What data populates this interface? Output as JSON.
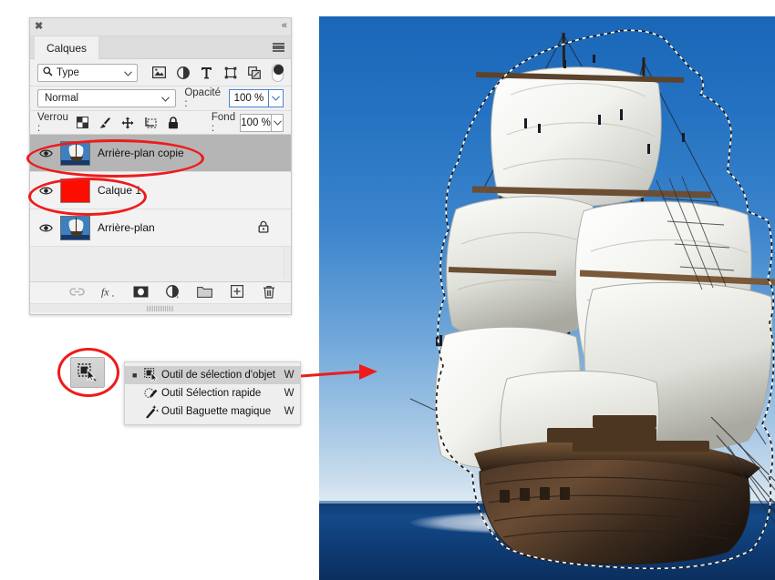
{
  "panel": {
    "title_tab": "Calques",
    "close_glyph": "✖",
    "collapse_glyph": "«",
    "filter": {
      "kind_value": "Type",
      "search_icon": "search-icon",
      "chevron": "∨",
      "icons": [
        "pixel-layer-filter-icon",
        "adjustment-layer-filter-icon",
        "type-layer-filter-icon",
        "shape-layer-filter-icon",
        "smart-object-filter-icon"
      ],
      "toggle_name": "filter-enable-toggle"
    },
    "blend": {
      "mode_value": "Normal",
      "opacity_label": "Opacité :",
      "opacity_value": "100 %",
      "chevron": "∨"
    },
    "lock": {
      "label": "Verrou :",
      "fill_label": "Fond :",
      "fill_value": "100 %",
      "icons": [
        "lock-transparency-icon",
        "lock-image-icon",
        "lock-position-icon",
        "lock-artboard-icon",
        "lock-all-icon"
      ]
    },
    "layers": [
      {
        "name": "Arrière-plan copie",
        "visible": true,
        "selected": true,
        "thumb": "ship-photo",
        "locked": false
      },
      {
        "name": "Calque 1",
        "visible": true,
        "selected": false,
        "thumb": "solid-red",
        "locked": false
      },
      {
        "name": "Arrière-plan",
        "visible": true,
        "selected": false,
        "thumb": "ship-photo",
        "locked": true
      }
    ],
    "bottom_icons": [
      "link-layers-icon",
      "layer-style-fx-icon",
      "layer-mask-icon",
      "new-adjustment-layer-icon",
      "new-group-icon",
      "new-layer-icon",
      "delete-layer-icon"
    ]
  },
  "toolbutton": {
    "name": "object-selection-tool-button",
    "tooltip": "Outil de sélection d'objet"
  },
  "flyout": {
    "items": [
      {
        "label": "Outil de sélection d'objet",
        "key": "W",
        "icon": "object-selection-icon",
        "active": true
      },
      {
        "label": "Outil Sélection rapide",
        "key": "W",
        "icon": "quick-selection-icon",
        "active": false
      },
      {
        "label": "Outil Baguette magique",
        "key": "W",
        "icon": "magic-wand-icon",
        "active": false
      }
    ]
  },
  "annotations": {
    "accent_color": "#ee1b1b",
    "ellipses": [
      "highlight-layer-row-1",
      "highlight-layer-row-2",
      "highlight-tool-button"
    ],
    "arrow": "arrow-from-menu-to-canvas"
  },
  "canvas": {
    "name": "document-canvas",
    "subject": "tall-ship-galleon-under-full-sail",
    "selection": "marching-ants-selection-around-ship",
    "sky_color": "#2573c2",
    "sea_color": "#10386e"
  }
}
